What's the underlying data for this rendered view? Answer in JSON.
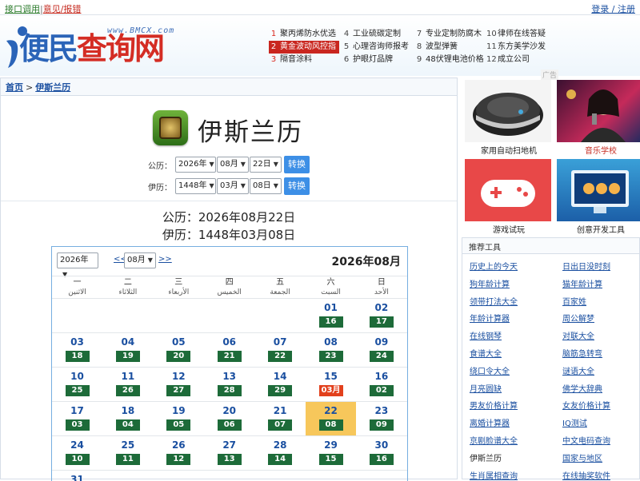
{
  "topbar": {
    "api_link": "接口调用",
    "feedback_link": "意见/报错",
    "login_link": "登录 / 注册"
  },
  "logo": {
    "text_main": "便民",
    "text_accent": "查询网",
    "url": "www.BMCX.com"
  },
  "hot_links": [
    {
      "num": "1",
      "label": "聚丙烯防水优选"
    },
    {
      "num": "2",
      "label": "黄金波动风控指"
    },
    {
      "num": "3",
      "label": "隔音涂料"
    },
    {
      "num": "4",
      "label": "工业硫碳定制"
    },
    {
      "num": "5",
      "label": "心理咨询师报考"
    },
    {
      "num": "6",
      "label": "护眼灯品牌"
    },
    {
      "num": "7",
      "label": "专业定制防腐木"
    },
    {
      "num": "8",
      "label": "波型弹簧"
    },
    {
      "num": "9",
      "label": "48伏锂电池价格"
    },
    {
      "num": "10",
      "label": "律师在线答疑"
    },
    {
      "num": "11",
      "label": "东方美学沙发"
    },
    {
      "num": "12",
      "label": "成立公司"
    }
  ],
  "ad_tag": "广告",
  "breadcrumb": {
    "home": "首页",
    "current": "伊斯兰历"
  },
  "page_title": "伊斯兰历",
  "converter": {
    "gregorian_label": "公历：",
    "gregorian_year": "2026年",
    "gregorian_month": "08月",
    "gregorian_day": "22日",
    "islamic_label": "伊历：",
    "islamic_year": "1448年",
    "islamic_month": "03月",
    "islamic_day": "08日",
    "convert_button": "转换"
  },
  "result": {
    "gregorian": "公历：2026年08月22日",
    "islamic": "伊历：1448年03月08日"
  },
  "calendar": {
    "year_select": "2026年",
    "month_select": "08月",
    "prev": "<<",
    "next": ">>",
    "title": "2026年08月",
    "weekdays": [
      {
        "cn": "一",
        "ar": "الاثنين"
      },
      {
        "cn": "二",
        "ar": "الثلاثاء"
      },
      {
        "cn": "三",
        "ar": "الأربعاء"
      },
      {
        "cn": "四",
        "ar": "الخميس"
      },
      {
        "cn": "五",
        "ar": "الجمعة"
      },
      {
        "cn": "六",
        "ar": "السبت"
      },
      {
        "cn": "日",
        "ar": "الأحد"
      }
    ],
    "weeks": [
      [
        null,
        null,
        null,
        null,
        null,
        {
          "g": "01",
          "h": "16"
        },
        {
          "g": "02",
          "h": "17"
        }
      ],
      [
        {
          "g": "03",
          "h": "18"
        },
        {
          "g": "04",
          "h": "19"
        },
        {
          "g": "05",
          "h": "20"
        },
        {
          "g": "06",
          "h": "21"
        },
        {
          "g": "07",
          "h": "22"
        },
        {
          "g": "08",
          "h": "23"
        },
        {
          "g": "09",
          "h": "24"
        }
      ],
      [
        {
          "g": "10",
          "h": "25"
        },
        {
          "g": "11",
          "h": "26"
        },
        {
          "g": "12",
          "h": "27"
        },
        {
          "g": "13",
          "h": "28"
        },
        {
          "g": "14",
          "h": "29"
        },
        {
          "g": "15",
          "h": "03月",
          "red": true
        },
        {
          "g": "16",
          "h": "02"
        }
      ],
      [
        {
          "g": "17",
          "h": "03"
        },
        {
          "g": "18",
          "h": "04"
        },
        {
          "g": "19",
          "h": "05"
        },
        {
          "g": "20",
          "h": "06"
        },
        {
          "g": "21",
          "h": "07"
        },
        {
          "g": "22",
          "h": "08",
          "today": true
        },
        {
          "g": "23",
          "h": "09"
        }
      ],
      [
        {
          "g": "24",
          "h": "10"
        },
        {
          "g": "25",
          "h": "11"
        },
        {
          "g": "26",
          "h": "12"
        },
        {
          "g": "27",
          "h": "13"
        },
        {
          "g": "28",
          "h": "14"
        },
        {
          "g": "29",
          "h": "15"
        },
        {
          "g": "30",
          "h": "16"
        }
      ],
      [
        {
          "g": "31",
          "h": ""
        },
        null,
        null,
        null,
        null,
        null,
        null
      ]
    ]
  },
  "ads": [
    {
      "caption": "家用自动扫地机",
      "highlight": false
    },
    {
      "caption": "音乐学校",
      "highlight": true
    },
    {
      "caption": "游戏试玩",
      "highlight": false
    },
    {
      "caption": "创意开发工具",
      "highlight": false
    }
  ],
  "tools": {
    "heading": "推荐工具",
    "items": [
      "历史上的今天",
      "日出日没时刻",
      "狗年龄计算",
      "猫年龄计算",
      "领带打法大全",
      "百家姓",
      "年龄计算器",
      "周公解梦",
      "在线钢琴",
      "对联大全",
      "食谱大全",
      "脑筋急转弯",
      "绕口令大全",
      "谜语大全",
      "月亮圆缺",
      "佛学大辞典",
      "男友价格计算",
      "女友价格计算",
      "离婚计算器",
      "IQ测试",
      "京剧脸谱大全",
      "中文电码查询",
      "伊斯兰历",
      "国家与地区",
      "生肖属相查询",
      "在线抽奖软件"
    ],
    "current": "伊斯兰历"
  },
  "colors": {
    "brand_blue": "#2b64b8",
    "brand_red": "#d42d24",
    "hijri_badge": "#1d6b39",
    "hijri_month_badge": "#e2401c",
    "today_bg": "#f7c75b",
    "convert_button": "#3d8fe6"
  }
}
